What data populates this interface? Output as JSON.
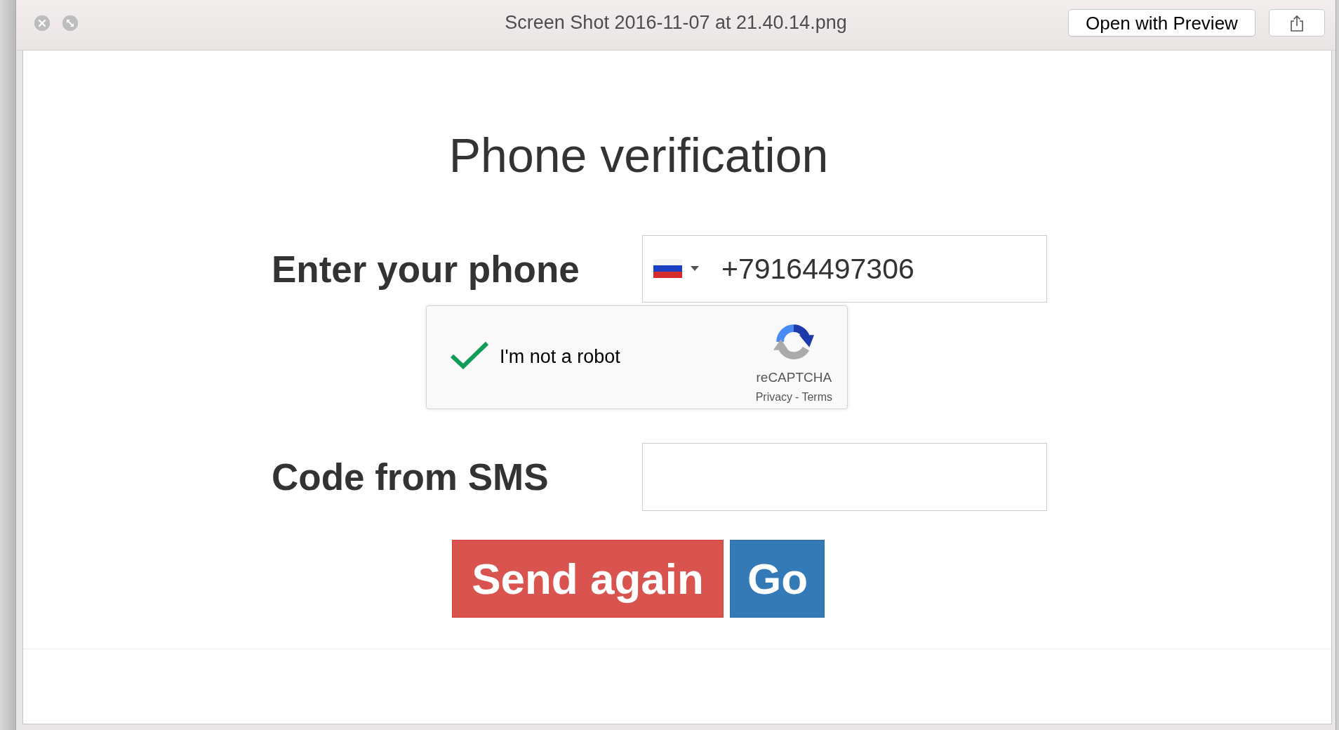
{
  "window": {
    "title": "Screen Shot 2016-11-07 at 21.40.14.png",
    "open_button": "Open with Preview"
  },
  "page": {
    "heading": "Phone verification",
    "phone": {
      "label": "Enter your phone",
      "value": "+79164497306"
    },
    "captcha": {
      "label": "I'm not a robot",
      "checked": true,
      "brand": "reCAPTCHA",
      "links": [
        "Privacy",
        "Terms"
      ],
      "separator": "-"
    },
    "code": {
      "label": "Code from SMS"
    },
    "buttons": [
      {
        "label": "Send again",
        "kind": "danger"
      },
      {
        "label": "Go",
        "kind": "primary"
      }
    ]
  }
}
